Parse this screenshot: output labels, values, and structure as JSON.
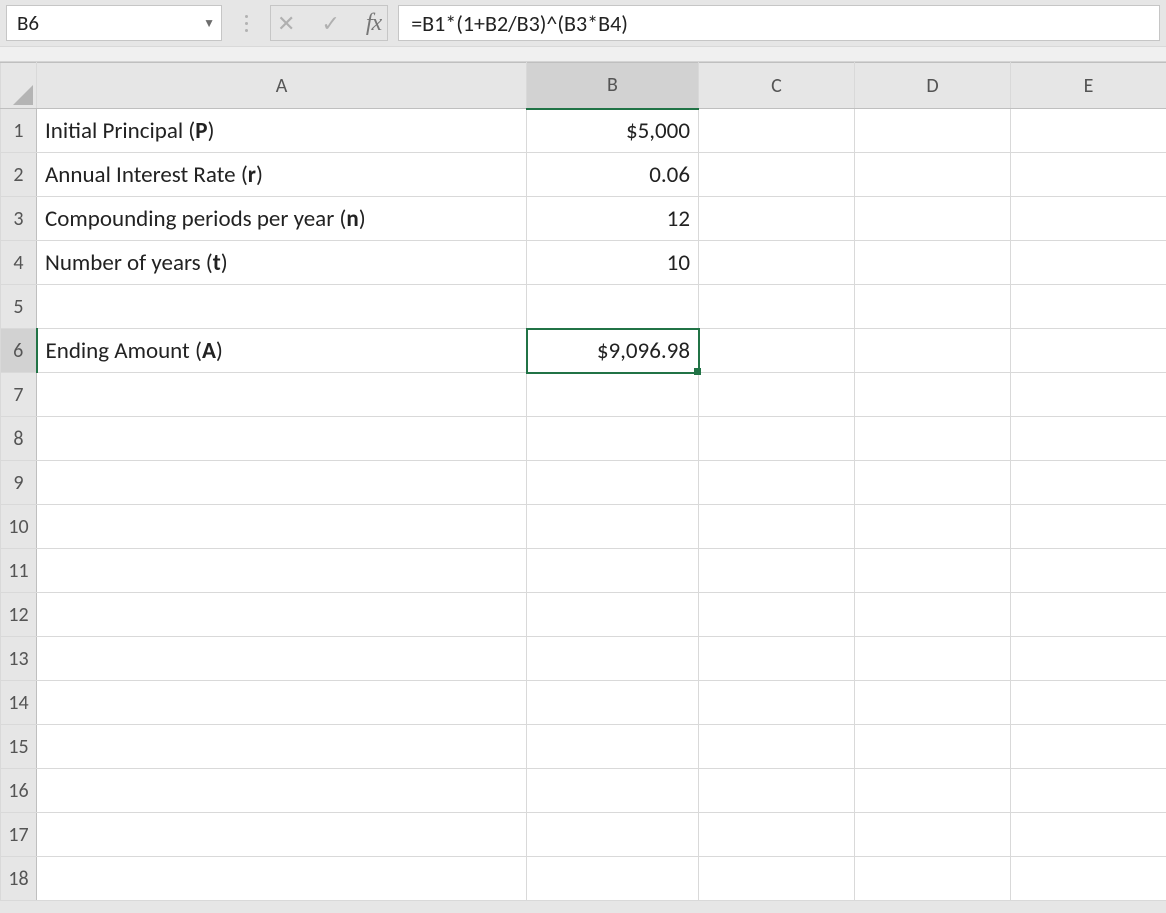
{
  "nameBox": {
    "value": "B6"
  },
  "formulaBar": {
    "value": "=B1*(1+B2/B3)^(B3*B4)"
  },
  "colHeaders": [
    "A",
    "B",
    "C",
    "D",
    "E"
  ],
  "rowHeaders": [
    "1",
    "2",
    "3",
    "4",
    "5",
    "6",
    "7",
    "8",
    "9",
    "10",
    "11",
    "12",
    "13",
    "14",
    "15",
    "16",
    "17",
    "18"
  ],
  "activeCell": {
    "col": "B",
    "row": 6
  },
  "cells": {
    "r1": {
      "aPre": "Initial Principal (",
      "aBold": "P",
      "aPost": ")",
      "b": "$5,000"
    },
    "r2": {
      "aPre": "Annual Interest Rate (",
      "aBold": "r",
      "aPost": ")",
      "b": "0.06"
    },
    "r3": {
      "aPre": "Compounding periods per year (",
      "aBold": "n",
      "aPost": ")",
      "b": "12"
    },
    "r4": {
      "aPre": "Number of years (",
      "aBold": "t",
      "aPost": ")",
      "b": "10"
    },
    "r6": {
      "aPre": "Ending Amount (",
      "aBold": "A",
      "aPost": ")",
      "b": "$9,096.98"
    }
  },
  "colors": {
    "accent": "#217346"
  }
}
